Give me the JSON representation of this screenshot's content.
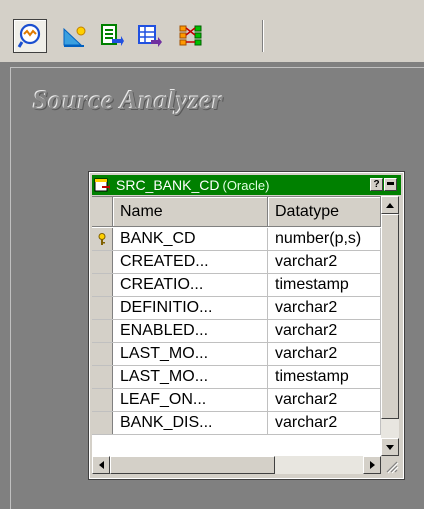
{
  "toolbar": {
    "buttons": [
      {
        "icon": "source-analyzer-icon",
        "pressed": true
      },
      {
        "icon": "target-designer-icon",
        "pressed": false
      },
      {
        "icon": "transformation-developer-icon",
        "pressed": false
      },
      {
        "icon": "mapplet-designer-icon",
        "pressed": false
      },
      {
        "icon": "mapping-designer-icon",
        "pressed": false
      }
    ]
  },
  "workspace": {
    "title": "Source Analyzer"
  },
  "source": {
    "name": "SRC_BANK_CD",
    "db_type": "(Oracle)",
    "help_btn": "?",
    "columns": {
      "name": "Name",
      "datatype": "Datatype"
    },
    "rows": [
      {
        "name": "BANK_CD",
        "datatype": "number(p,s)",
        "key": true
      },
      {
        "name": "CREATED...",
        "datatype": "varchar2",
        "key": false
      },
      {
        "name": "CREATIO...",
        "datatype": "timestamp",
        "key": false
      },
      {
        "name": "DEFINITIO...",
        "datatype": "varchar2",
        "key": false
      },
      {
        "name": "ENABLED...",
        "datatype": "varchar2",
        "key": false
      },
      {
        "name": "LAST_MO...",
        "datatype": "varchar2",
        "key": false
      },
      {
        "name": "LAST_MO...",
        "datatype": "timestamp",
        "key": false
      },
      {
        "name": "LEAF_ON...",
        "datatype": "varchar2",
        "key": false
      },
      {
        "name": "BANK_DIS...",
        "datatype": "varchar2",
        "key": false
      }
    ]
  },
  "colors": {
    "title_bar": "#008000",
    "toolbar_bg": "#d4d0c8",
    "workspace_bg": "#808080"
  }
}
